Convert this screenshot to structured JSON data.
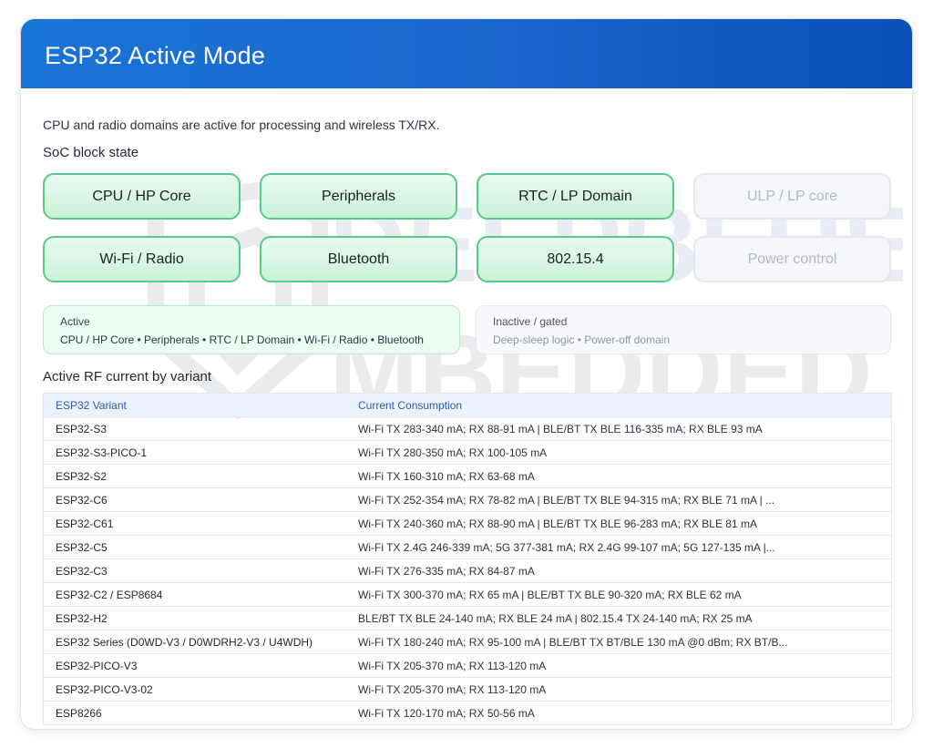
{
  "header": {
    "title": "ESP32 Active Mode"
  },
  "description": "CPU and radio domains are active for processing and wireless TX/RX.",
  "soc_section_title": "SoC block state",
  "blocks": [
    {
      "label": "CPU / HP Core",
      "state": "active"
    },
    {
      "label": "Peripherals",
      "state": "active"
    },
    {
      "label": "RTC / LP Domain",
      "state": "active"
    },
    {
      "label": "ULP / LP core",
      "state": "inactive"
    },
    {
      "label": "Wi-Fi / Radio",
      "state": "active"
    },
    {
      "label": "Bluetooth",
      "state": "active"
    },
    {
      "label": "802.15.4",
      "state": "active"
    },
    {
      "label": "Power control",
      "state": "inactive"
    }
  ],
  "legend": {
    "active_title": "Active",
    "active_items": "CPU / HP Core • Peripherals • RTC / LP Domain • Wi-Fi / Radio • Bluetooth",
    "inactive_title": "Inactive / gated",
    "inactive_items": "Deep-sleep logic • Power-off domain"
  },
  "table_section_title": "Active RF current by variant",
  "table": {
    "headers": [
      "ESP32 Variant",
      "Current Consumption"
    ],
    "rows": [
      [
        "ESP32-S3",
        "Wi-Fi TX 283-340 mA; RX 88-91 mA | BLE/BT TX BLE 116-335 mA; RX BLE 93 mA"
      ],
      [
        "ESP32-S3-PICO-1",
        "Wi-Fi TX 280-350 mA; RX 100-105 mA"
      ],
      [
        "ESP32-S2",
        "Wi-Fi TX 160-310 mA; RX 63-68 mA"
      ],
      [
        "ESP32-C6",
        "Wi-Fi TX 252-354 mA; RX 78-82 mA | BLE/BT TX BLE 94-315 mA; RX BLE 71 mA | ..."
      ],
      [
        "ESP32-C61",
        "Wi-Fi TX 240-360 mA; RX 88-90 mA | BLE/BT TX BLE 96-283 mA; RX BLE 81 mA"
      ],
      [
        "ESP32-C5",
        "Wi-Fi TX 2.4G 246-339 mA; 5G 377-381 mA; RX 2.4G 99-107 mA; 5G 127-135 mA |..."
      ],
      [
        "ESP32-C3",
        "Wi-Fi TX 276-335 mA; RX 84-87 mA"
      ],
      [
        "ESP32-C2 / ESP8684",
        "Wi-Fi TX 300-370 mA; RX 65 mA | BLE/BT TX BLE 90-320 mA; RX BLE 62 mA"
      ],
      [
        "ESP32-H2",
        "BLE/BT TX BLE 24-140 mA; RX BLE 24 mA | 802.15.4 TX 24-140 mA; RX 25 mA"
      ],
      [
        "ESP32 Series (D0WD-V3 / D0WDRH2-V3 / U4WDH)",
        "Wi-Fi TX 180-240 mA; RX 95-100 mA | BLE/BT TX BT/BLE 130 mA @0 dBm; RX BT/B..."
      ],
      [
        "ESP32-PICO-V3",
        "Wi-Fi TX 205-370 mA; RX 113-120 mA"
      ],
      [
        "ESP32-PICO-V3-02",
        "Wi-Fi TX 205-370 mA; RX 113-120 mA"
      ],
      [
        "ESP8266",
        "Wi-Fi TX 120-170 mA; RX 50-56 mA"
      ]
    ]
  },
  "watermark": {
    "line1": "DEEPBLUE",
    "line2": "MBEDDED"
  },
  "colors": {
    "header_start": "#1a74d6",
    "header_end": "#0a4fb6",
    "active_border": "#58c989",
    "active_fill": "#c9f2d8",
    "inactive_fill": "#f4f6f9",
    "table_header": "#eaf2fd"
  }
}
